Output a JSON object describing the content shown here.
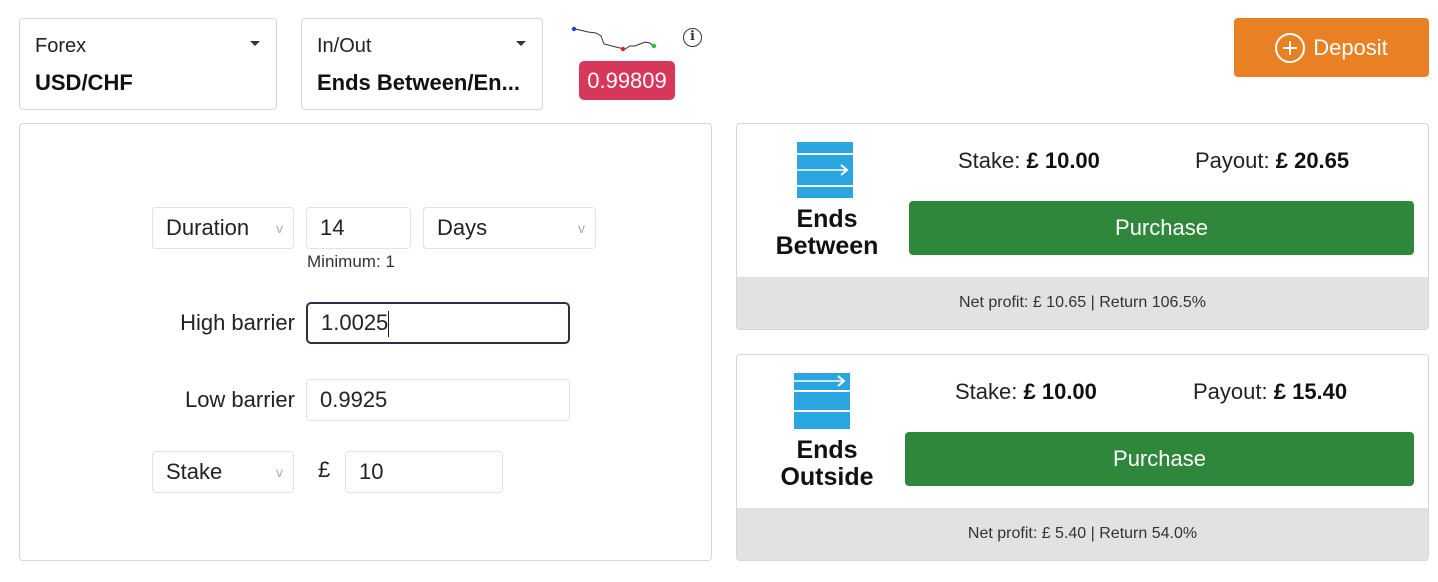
{
  "market": {
    "category": "Forex",
    "symbol": "USD/CHF"
  },
  "trade_type": {
    "category": "In/Out",
    "value": "Ends Between/En..."
  },
  "spot": {
    "price": "0.99809",
    "color": "#d7375a"
  },
  "info_icon": "info-icon",
  "deposit": {
    "label": "Deposit",
    "color": "#e98024"
  },
  "params": {
    "duration_select": "Duration",
    "duration_value": "14",
    "duration_unit": "Days",
    "duration_min": "Minimum: 1",
    "high_barrier_label": "High barrier",
    "high_barrier_value": "1.0025",
    "low_barrier_label": "Low barrier",
    "low_barrier_value": "0.9925",
    "stake_select": "Stake",
    "currency": "£",
    "stake_value": "10"
  },
  "contracts": [
    {
      "name_line1": "Ends",
      "name_line2": "Between",
      "stake_label": "Stake:",
      "stake_value": "£ 10.00",
      "payout_label": "Payout:",
      "payout_value": "£ 20.65",
      "purchase_label": "Purchase",
      "footer": "Net profit: £ 10.65 | Return 106.5%"
    },
    {
      "name_line1": "Ends",
      "name_line2": "Outside",
      "stake_label": "Stake:",
      "stake_value": "£ 10.00",
      "payout_label": "Payout:",
      "payout_value": "£ 15.40",
      "purchase_label": "Purchase",
      "footer": "Net profit: £ 5.40 | Return 54.0%"
    }
  ],
  "colors": {
    "purchase": "#2e873a",
    "contract_icon": "#29a6e0",
    "footer_bg": "#e2e2e2"
  }
}
